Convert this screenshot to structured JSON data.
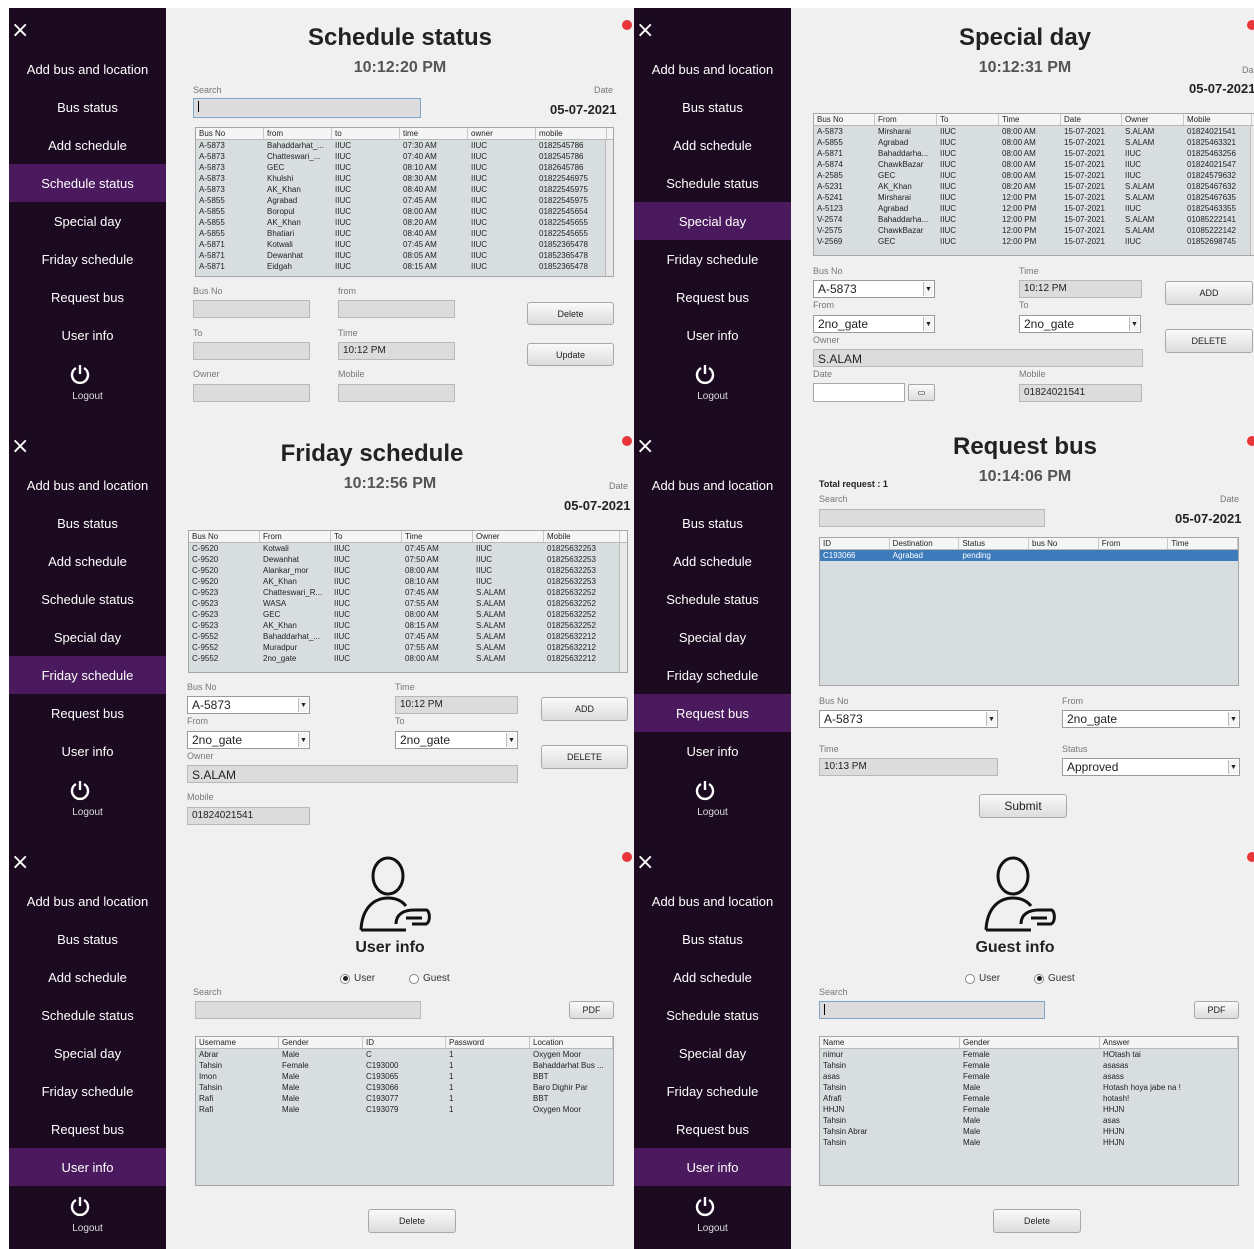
{
  "nav": {
    "close_icon": "×",
    "items": [
      "Add bus and location",
      "Bus status",
      "Add schedule",
      "Schedule status",
      "Special day",
      "Friday schedule",
      "Request bus",
      "User info"
    ],
    "logout": "Logout"
  },
  "schedule_status": {
    "title": "Schedule status",
    "clock": "10:12:20 PM",
    "search_label": "Search",
    "date_label": "Date",
    "date": "05-07-2021",
    "columns": [
      "Bus No",
      "from",
      "to",
      "time",
      "owner",
      "mobile"
    ],
    "rows": [
      [
        "A-5873",
        "Bahaddarhat_...",
        "IIUC",
        "07:30 AM",
        "IIUC",
        "0182545786"
      ],
      [
        "A-5873",
        "Chatteswari_...",
        "IIUC",
        "07:40 AM",
        "IIUC",
        "0182545786"
      ],
      [
        "A-5873",
        "GEC",
        "IIUC",
        "08:10 AM",
        "IIUC",
        "0182645786"
      ],
      [
        "A-5873",
        "Khulshi",
        "IIUC",
        "08:30 AM",
        "IIUC",
        "01822546975"
      ],
      [
        "A-5873",
        "AK_Khan",
        "IIUC",
        "08:40 AM",
        "IIUC",
        "01822545975"
      ],
      [
        "A-5855",
        "Agrabad",
        "IIUC",
        "07:45 AM",
        "IIUC",
        "01822545975"
      ],
      [
        "A-5855",
        "Boropul",
        "IIUC",
        "08:00 AM",
        "IIUC",
        "01822545654"
      ],
      [
        "A-5855",
        "AK_Khan",
        "IIUC",
        "08:20 AM",
        "IIUC",
        "01822545655"
      ],
      [
        "A-5855",
        "Bhatiari",
        "IIUC",
        "08:40 AM",
        "IIUC",
        "01822545655"
      ],
      [
        "A-5871",
        "Kotwali",
        "IIUC",
        "07:45 AM",
        "IIUC",
        "01852365478"
      ],
      [
        "A-5871",
        "Dewanhat",
        "IIUC",
        "08:05 AM",
        "IIUC",
        "01852365478"
      ],
      [
        "A-5871",
        "Eidgah",
        "IIUC",
        "08:15 AM",
        "IIUC",
        "01852365478"
      ]
    ],
    "bus_no_label": "Bus No",
    "from_label": "from",
    "to_label": "To",
    "time_label": "Time",
    "time_value": "10:12 PM",
    "owner_label": "Owner",
    "mobile_label": "Mobile",
    "delete": "Delete",
    "update": "Update"
  },
  "special_day": {
    "title": "Special day",
    "clock": "10:12:31 PM",
    "date_label": "Date",
    "date": "05-07-2021",
    "columns": [
      "Bus No",
      "From",
      "To",
      "Time",
      "Date",
      "Owner",
      "Mobile"
    ],
    "rows": [
      [
        "A-5873",
        "Mirsharai",
        "IIUC",
        "08:00 AM",
        "15-07-2021",
        "S.ALAM",
        "01824021541"
      ],
      [
        "A-5855",
        "Agrabad",
        "IIUC",
        "08:00 AM",
        "15-07-2021",
        "S.ALAM",
        "01825463321"
      ],
      [
        "A-5871",
        "Bahaddarha...",
        "IIUC",
        "08:00 AM",
        "15-07-2021",
        "IIUC",
        "01825463256"
      ],
      [
        "A-5874",
        "ChawkBazar",
        "IIUC",
        "08:00 AM",
        "15-07-2021",
        "IIUC",
        "01824021547"
      ],
      [
        "A-2585",
        "GEC",
        "IIUC",
        "08:00 AM",
        "15-07-2021",
        "IIUC",
        "01824579632"
      ],
      [
        "A-5231",
        "AK_Khan",
        "IIUC",
        "08:20 AM",
        "15-07-2021",
        "S.ALAM",
        "01825467632"
      ],
      [
        "A-5241",
        "Mirsharai",
        "IIUC",
        "12:00 PM",
        "15-07-2021",
        "S.ALAM",
        "01825467635"
      ],
      [
        "A-5123",
        "Agrabad",
        "IIUC",
        "12:00 PM",
        "15-07-2021",
        "IIUC",
        "01825463355"
      ],
      [
        "V-2574",
        "Bahaddarha...",
        "IIUC",
        "12:00 PM",
        "15-07-2021",
        "S.ALAM",
        "01085222141"
      ],
      [
        "V-2575",
        "ChawkBazar",
        "IIUC",
        "12:00 PM",
        "15-07-2021",
        "S.ALAM",
        "01085222142"
      ],
      [
        "V-2569",
        "GEC",
        "IIUC",
        "12:00 PM",
        "15-07-2021",
        "IIUC",
        "01852698745"
      ]
    ],
    "bus_no_label": "Bus No",
    "bus_no": "A-5873",
    "time_label": "Time",
    "time_value": "10:12 PM",
    "from_label": "From",
    "from": "2no_gate",
    "to_label": "To",
    "to": "2no_gate",
    "owner_label": "Owner",
    "owner": "S.ALAM",
    "date_field_label": "Date",
    "mobile_label": "Mobile",
    "mobile": "01824021541",
    "add": "ADD",
    "delete": "DELETE"
  },
  "friday": {
    "title": "Friday schedule",
    "clock": "10:12:56 PM",
    "date_label": "Date",
    "date": "05-07-2021",
    "columns": [
      "Bus No",
      "From",
      "To",
      "Time",
      "Owner",
      "Mobile"
    ],
    "rows": [
      [
        "C-9520",
        "Kotwali",
        "IIUC",
        "07:45 AM",
        "IIUC",
        "01825632253"
      ],
      [
        "C-9520",
        "Dewanhat",
        "IIUC",
        "07:50 AM",
        "IIUC",
        "01825632253"
      ],
      [
        "C-9520",
        "Alankar_mor",
        "IIUC",
        "08:00 AM",
        "IIUC",
        "01825632253"
      ],
      [
        "C-9520",
        "AK_Khan",
        "IIUC",
        "08:10 AM",
        "IIUC",
        "01825632253"
      ],
      [
        "C-9523",
        "Chatteswari_R...",
        "IIUC",
        "07:45 AM",
        "S.ALAM",
        "01825632252"
      ],
      [
        "C-9523",
        "WASA",
        "IIUC",
        "07:55 AM",
        "S.ALAM",
        "01825632252"
      ],
      [
        "C-9523",
        "GEC",
        "IIUC",
        "08:00 AM",
        "S.ALAM",
        "01825632252"
      ],
      [
        "C-9523",
        "AK_Khan",
        "IIUC",
        "08:15 AM",
        "S.ALAM",
        "01825632252"
      ],
      [
        "C-9552",
        "Bahaddarhat_...",
        "IIUC",
        "07:45 AM",
        "S.ALAM",
        "01825632212"
      ],
      [
        "C-9552",
        "Muradpur",
        "IIUC",
        "07:55 AM",
        "S.ALAM",
        "01825632212"
      ],
      [
        "C-9552",
        "2no_gate",
        "IIUC",
        "08:00 AM",
        "S.ALAM",
        "01825632212"
      ]
    ],
    "bus_no_label": "Bus No",
    "bus_no": "A-5873",
    "time_label": "Time",
    "time_value": "10:12 PM",
    "from_label": "From",
    "from": "2no_gate",
    "to_label": "To",
    "to": "2no_gate",
    "owner_label": "Owner",
    "owner": "S.ALAM",
    "mobile_label": "Mobile",
    "mobile": "01824021541",
    "add": "ADD",
    "delete": "DELETE"
  },
  "request": {
    "title": "Request bus",
    "clock": "10:14:06 PM",
    "total_request": "Total request : 1",
    "search_label": "Search",
    "date_label": "Date",
    "date": "05-07-2021",
    "columns": [
      "ID",
      "Destination",
      "Status",
      "bus No",
      "From",
      "Time"
    ],
    "rows": [
      [
        "C193066",
        "Agrabad",
        "pending",
        "",
        "",
        ""
      ]
    ],
    "bus_no_label": "Bus No",
    "bus_no": "A-5873",
    "from_label": "From",
    "from": "2no_gate",
    "time_label": "Time",
    "time_value": "10:13 PM",
    "status_label": "Status",
    "status": "Approved",
    "submit": "Submit"
  },
  "user_info": {
    "title": "User info",
    "radio_user": "User",
    "radio_guest": "Guest",
    "search_label": "Search",
    "pdf": "PDF",
    "columns": [
      "Username",
      "Gender",
      "ID",
      "Password",
      "Location"
    ],
    "rows": [
      [
        "Abrar",
        "Male",
        "C",
        "1",
        "Oxygen Moor"
      ],
      [
        "Tahsin",
        "Female",
        "C193000",
        "1",
        "Bahaddarhat Bus ..."
      ],
      [
        "Imon",
        "Male",
        "C193065",
        "1",
        "BBT"
      ],
      [
        "Tahsin",
        "Male",
        "C193066",
        "1",
        "Baro Dighir Par"
      ],
      [
        "Rafi",
        "Male",
        "C193077",
        "1",
        "BBT"
      ],
      [
        "Rafi",
        "Male",
        "C193079",
        "1",
        "Oxygen Moor"
      ]
    ],
    "delete": "Delete"
  },
  "guest_info": {
    "title": "Guest info",
    "radio_user": "User",
    "radio_guest": "Guest",
    "search_label": "Search",
    "pdf": "PDF",
    "columns": [
      "Name",
      "Gender",
      "Answer"
    ],
    "rows": [
      [
        "nimur",
        "Female",
        "HOtash tai"
      ],
      [
        "Tahsin",
        "Female",
        "asasas"
      ],
      [
        "asas",
        "Female",
        "asass"
      ],
      [
        "Tahsin",
        "Male",
        "Hotash hoya jabe na !"
      ],
      [
        "Afrafi",
        "Female",
        "hotash!"
      ],
      [
        "HHJN",
        "Female",
        "HHJN"
      ],
      [
        "Tahsin",
        "Male",
        "asas"
      ],
      [
        "Tahsin Abrar",
        "Male",
        "HHJN"
      ],
      [
        "Tahsin",
        "Male",
        "HHJN"
      ]
    ],
    "delete": "Delete"
  }
}
